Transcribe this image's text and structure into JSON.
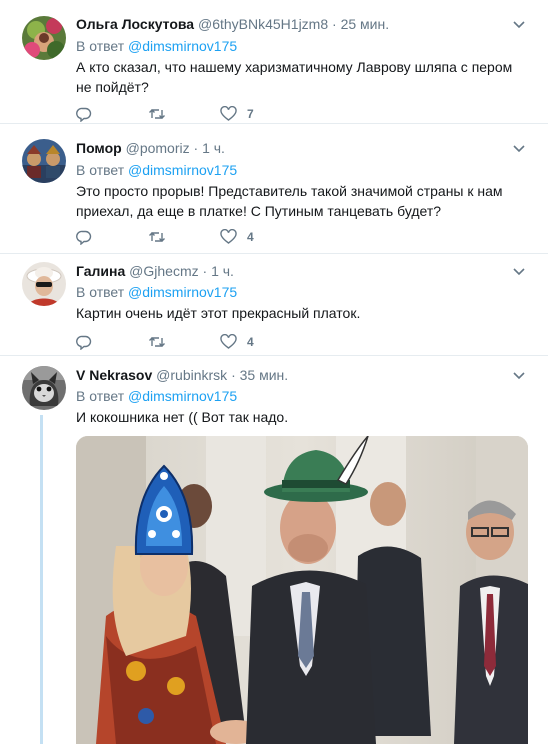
{
  "colors": {
    "accent": "#1da1f2",
    "muted": "#657786",
    "text": "#14171a",
    "divider": "#e6ecf0",
    "thread": "#c4e0f3"
  },
  "reply_prefix": "В ответ",
  "tweets": [
    {
      "name": "Ольга Лоскутова",
      "handle": "@6thyBNk45H1jzm8",
      "separator": "·",
      "time": "25 мин.",
      "mention": "@dimsmirnov175",
      "text": "А кто сказал, что нашему харизматичному Лаврову шляпа с пером не пойдёт?",
      "likes": "7"
    },
    {
      "name": "Помор",
      "handle": "@pomoriz",
      "separator": "·",
      "time": "1 ч.",
      "mention": "@dimsmirnov175",
      "text": "Это просто прорыв! Представитель такой значимой страны к нам приехал, да еще в платке! С Путиным танцевать будет?",
      "likes": "4"
    },
    {
      "name": "Галина",
      "handle": "@Gjhecmz",
      "separator": "·",
      "time": "1 ч.",
      "mention": "@dimsmirnov175",
      "text": "Картин очень идёт этот прекрасный платок.",
      "likes": "4"
    },
    {
      "name": "V Nekrasov",
      "handle": "@rubinkrsk",
      "separator": "·",
      "time": "35 мин.",
      "mention": "@dimsmirnov175",
      "text": "И кокошника нет (( Вот так надо.",
      "media": "photo"
    }
  ],
  "icons": {
    "caret": "chevron-down-icon",
    "reply": "reply-icon",
    "retweet": "retweet-icon",
    "like": "heart-icon"
  }
}
